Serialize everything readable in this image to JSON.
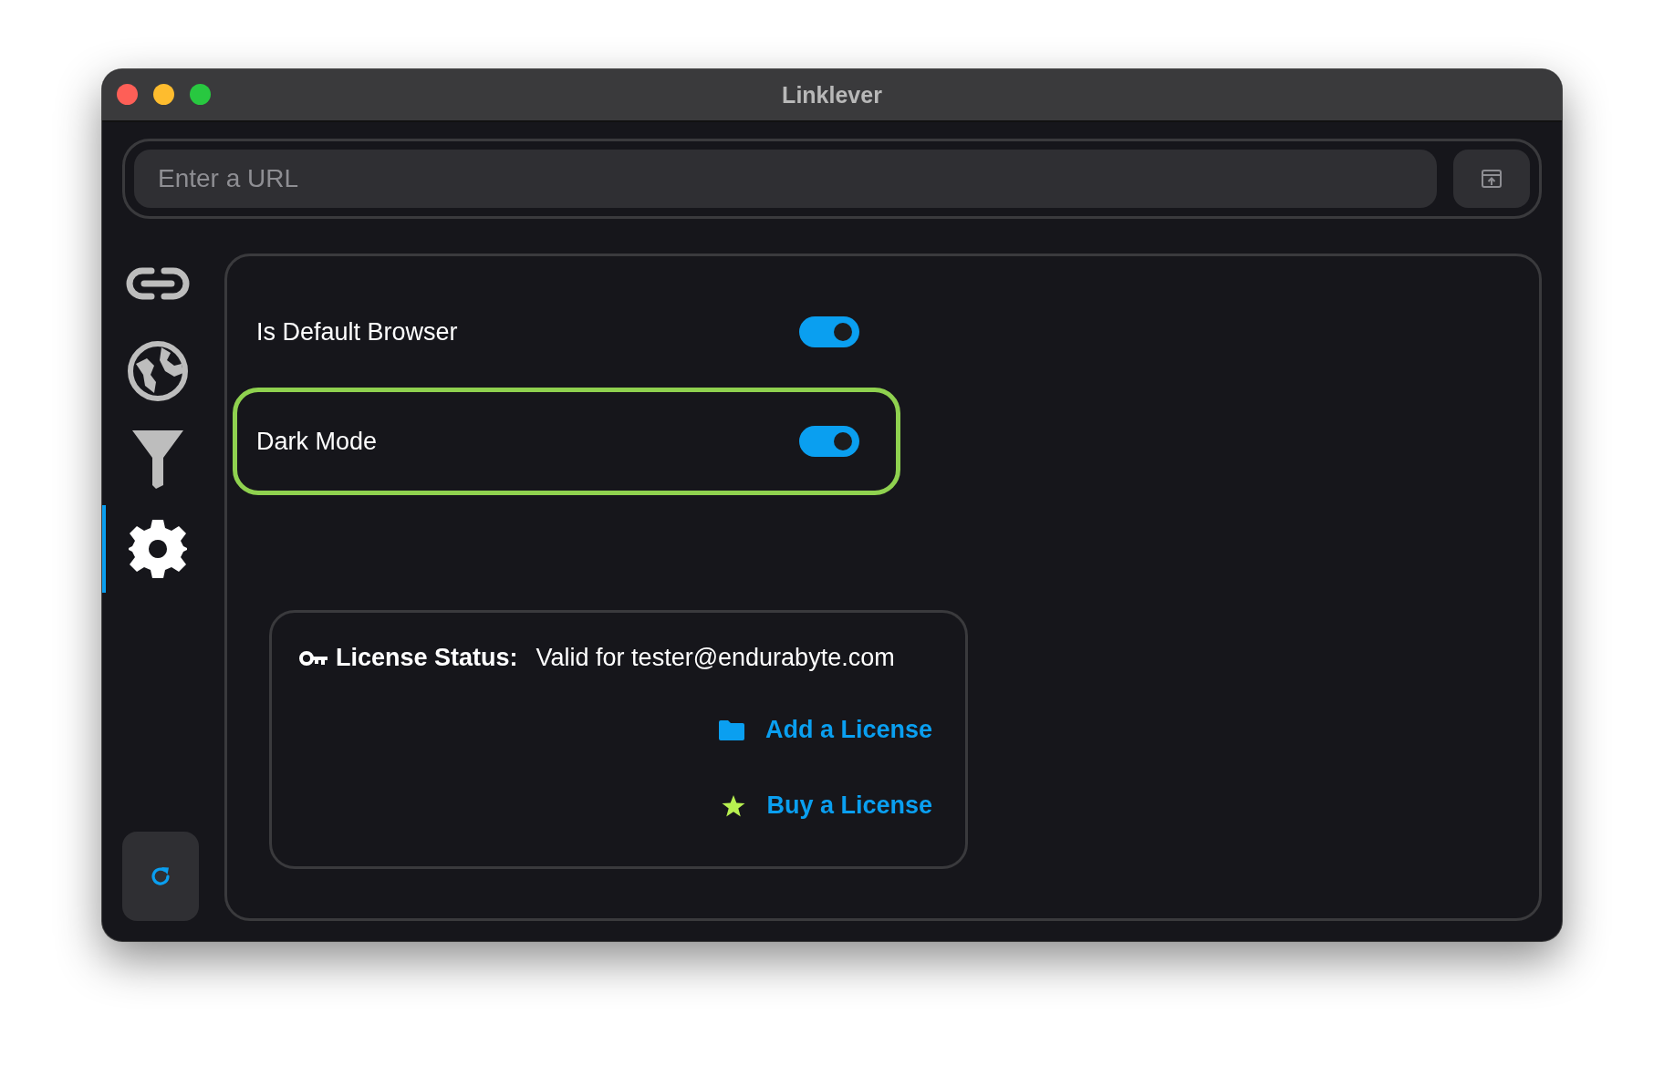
{
  "window": {
    "title": "Linklever"
  },
  "url_bar": {
    "placeholder": "Enter a URL"
  },
  "sidebar": {
    "items": [
      {
        "kind": "link",
        "selected": false
      },
      {
        "kind": "globe",
        "selected": false
      },
      {
        "kind": "filter",
        "selected": false
      },
      {
        "kind": "settings",
        "selected": true
      }
    ]
  },
  "settings": [
    {
      "label": "Is Default Browser",
      "on": true,
      "focused": false
    },
    {
      "label": "Dark Mode",
      "on": true,
      "focused": true
    }
  ],
  "license": {
    "label": "License Status:",
    "value": "Valid for tester@endurabyte.com",
    "actions": [
      {
        "kind": "folder",
        "label": "Add a License"
      },
      {
        "kind": "star",
        "label": "Buy a License"
      }
    ]
  }
}
